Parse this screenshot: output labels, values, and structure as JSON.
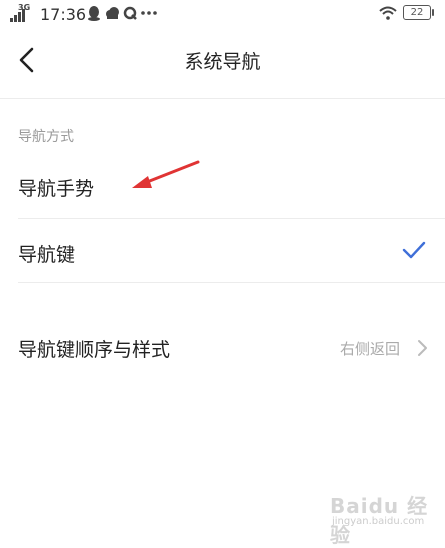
{
  "status_bar": {
    "network": "3G",
    "time": "17:36",
    "icons": [
      "signal-icon",
      "qq-icon",
      "cloud-icon",
      "q-icon",
      "more-dots-icon",
      "wifi-icon",
      "battery-icon"
    ],
    "battery": "22"
  },
  "header": {
    "title": "系统导航"
  },
  "section": {
    "title": "导航方式"
  },
  "options": [
    {
      "label": "导航手势",
      "selected": false
    },
    {
      "label": "导航键",
      "selected": true
    }
  ],
  "order_row": {
    "label": "导航键顺序与样式",
    "value": "右侧返回"
  },
  "watermark": {
    "main": "Baidu 经验",
    "sub": "jingyan.baidu.com"
  },
  "colors": {
    "accent": "#3f6fd8",
    "annotation_arrow": "#e03434"
  }
}
